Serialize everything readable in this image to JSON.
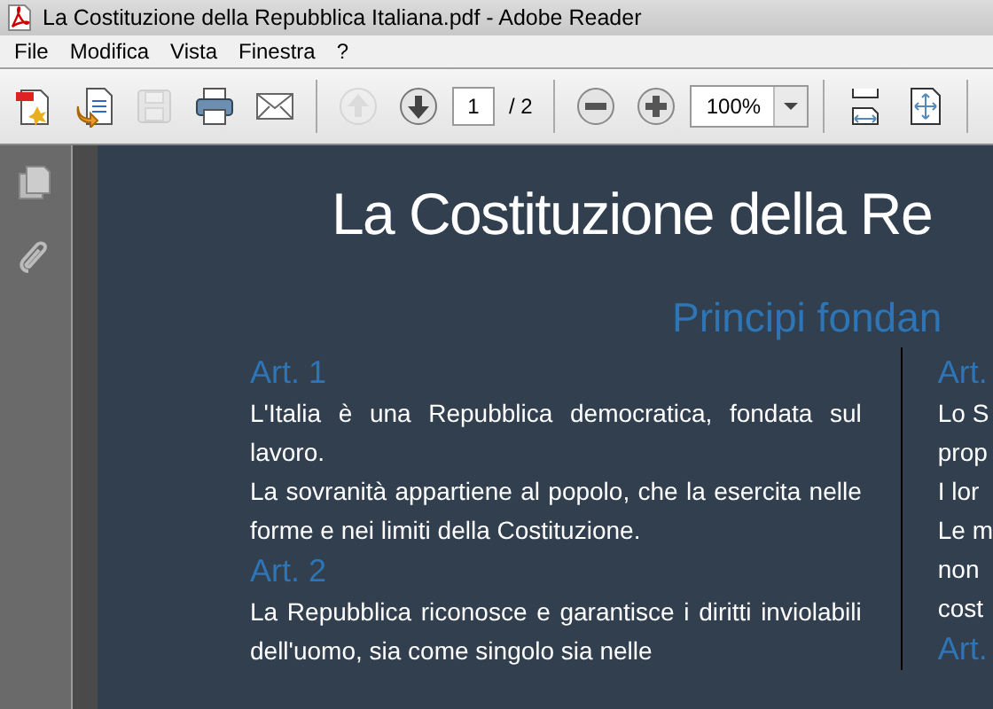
{
  "window": {
    "title": "La Costituzione della Repubblica Italiana.pdf - Adobe Reader"
  },
  "menu": [
    "File",
    "Modifica",
    "Vista",
    "Finestra",
    "?"
  ],
  "toolbar": {
    "file_buttons": [
      {
        "disabled": false
      },
      {
        "disabled": false
      },
      {
        "disabled": true
      },
      {
        "disabled": false
      },
      {
        "disabled": false
      }
    ],
    "nav_buttons": [
      {
        "disabled": true
      },
      {
        "disabled": false
      }
    ],
    "page_field": {
      "value": "1"
    },
    "page_total": "/ 2",
    "zoom_field": {
      "value": "100%"
    }
  },
  "document": {
    "title": "La Costituzione della Re",
    "subtitle": "Principi fondan",
    "left_column": [
      {
        "kind": "heading",
        "text": "Art. 1"
      },
      {
        "kind": "paragraph",
        "text": "L'Italia è una Repubblica democratica, fondata sul lavoro."
      },
      {
        "kind": "paragraph",
        "text": "La sovranità appartiene al popolo, che la esercita nelle forme e nei limiti della Costituzione."
      },
      {
        "kind": "heading",
        "text": "Art. 2"
      },
      {
        "kind": "paragraph",
        "text": "La Repubblica riconosce e garantisce i diritti inviolabili dell'uomo, sia come singolo sia nelle"
      }
    ],
    "right_column": [
      {
        "kind": "heading",
        "text": "Art."
      },
      {
        "kind": "line",
        "text": "Lo S"
      },
      {
        "kind": "line",
        "text": "prop"
      },
      {
        "kind": "line",
        "text": "I lor"
      },
      {
        "kind": "line",
        "text": "Le m"
      },
      {
        "kind": "line",
        "text": "non"
      },
      {
        "kind": "line",
        "text": "cost"
      },
      {
        "kind": "heading",
        "text": "Art."
      }
    ]
  }
}
